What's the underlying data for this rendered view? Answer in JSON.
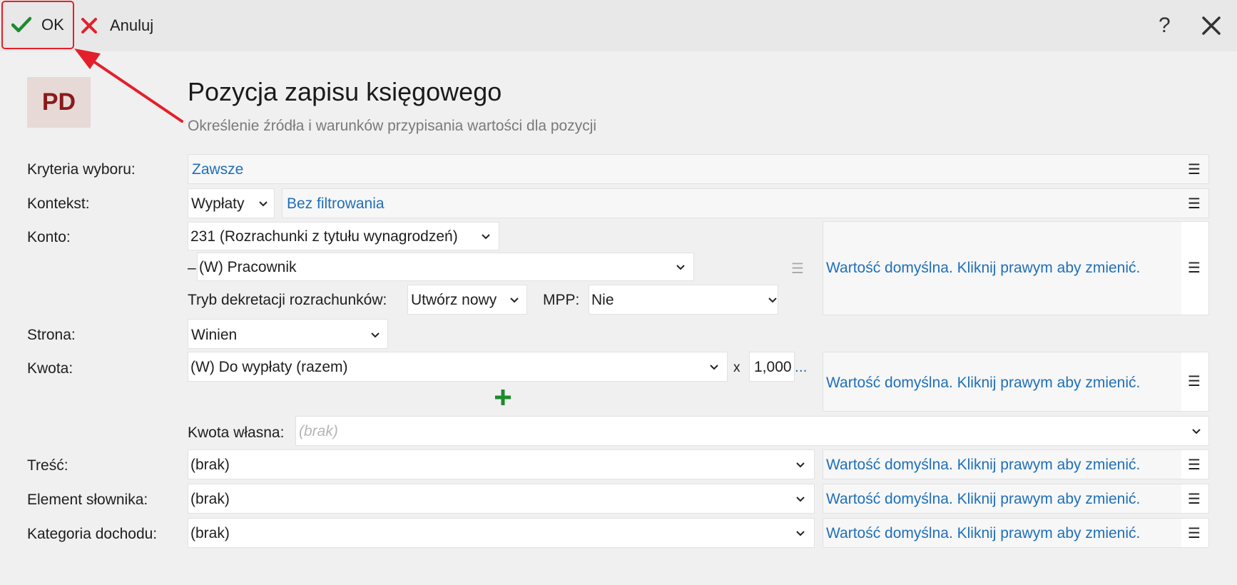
{
  "toolbar": {
    "ok_label": "OK",
    "cancel_label": "Anuluj",
    "help_label": "?"
  },
  "header": {
    "logo": "PD",
    "title": "Pozycja zapisu księgowego",
    "subtitle": "Określenie źródła i warunków przypisania wartości dla pozycji"
  },
  "form": {
    "kryteria": {
      "label": "Kryteria wyboru:",
      "value": "Zawsze"
    },
    "kontekst": {
      "label": "Kontekst:",
      "select": "Wypłaty",
      "filter": "Bez filtrowania"
    },
    "konto": {
      "label": "Konto:",
      "account": "231 (Rozrachunki z tytułu wynagrodzeń)",
      "dash": "–",
      "sub_account": "(W) Pracownik",
      "tryb_label": "Tryb dekretacji rozrachunków:",
      "tryb_value": "Utwórz nowy",
      "mpp_label": "MPP:",
      "mpp_value": "Nie",
      "default_hint": "Wartość domyślna. Kliknij prawym aby zmienić."
    },
    "strona": {
      "label": "Strona:",
      "value": "Winien"
    },
    "kwota": {
      "label": "Kwota:",
      "value": "(W) Do wypłaty (razem)",
      "multiply": "x",
      "factor": "1,000",
      "ellipsis": "...",
      "default_hint": "Wartość domyślna. Kliknij prawym aby zmienić.",
      "own_label": "Kwota własna:",
      "own_placeholder": "(brak)"
    },
    "tresc": {
      "label": "Treść:",
      "value": "(brak)",
      "default_hint": "Wartość domyślna. Kliknij prawym aby zmienić."
    },
    "element": {
      "label": "Element słownika:",
      "value": "(brak)",
      "default_hint": "Wartość domyślna. Kliknij prawym aby zmienić."
    },
    "kategoria": {
      "label": "Kategoria dochodu:",
      "value": "(brak)",
      "default_hint": "Wartość domyślna. Kliknij prawym aby zmienić."
    }
  },
  "icons": {
    "ok": "check-icon",
    "cancel": "x-icon",
    "close": "close-icon",
    "menu": "hamburger-menu-icon",
    "dropdown": "chevron-down-icon",
    "add": "plus-icon",
    "annotation": "red-arrow-annotation"
  },
  "colors": {
    "ok_check": "#1e8a2e",
    "cancel_x": "#e3202a",
    "link": "#1f6fba",
    "logo_text": "#8b1a1a",
    "highlight": "#e3202a",
    "plus": "#1e8a2e"
  }
}
